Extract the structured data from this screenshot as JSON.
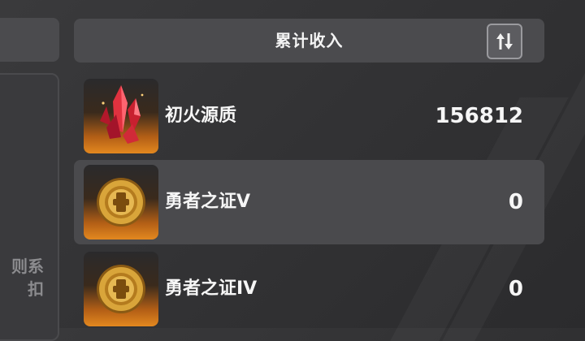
{
  "header": {
    "title": "累计收入"
  },
  "left": {
    "text_line1": "则系",
    "text_line2": "扣"
  },
  "items": [
    {
      "name": "初火源质",
      "value": "156812",
      "icon": "red-crystal-icon"
    },
    {
      "name": "勇者之证V",
      "value": "0",
      "icon": "gold-medal-icon"
    },
    {
      "name": "勇者之证IV",
      "value": "0",
      "icon": "gold-medal-icon"
    }
  ],
  "colors": {
    "panel": "#4b4b4e",
    "accent_orange": "#e3881f",
    "crystal": "#e0323f",
    "gold": "#d9a53a"
  }
}
